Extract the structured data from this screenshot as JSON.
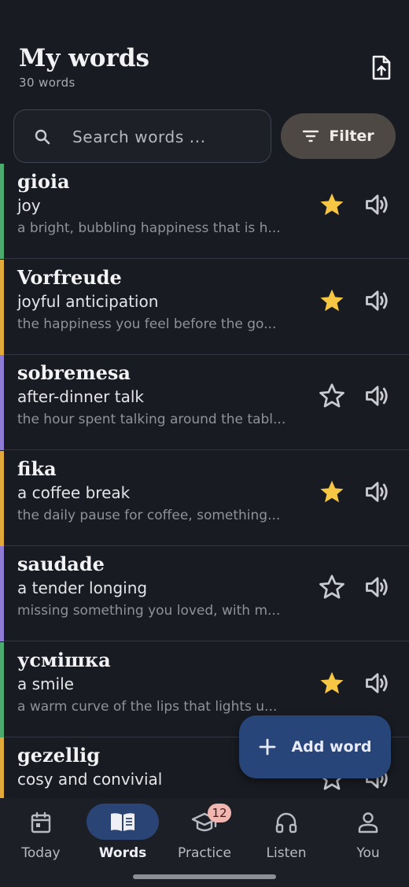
{
  "header": {
    "title": "My words",
    "subtitle": "30 words",
    "export_icon": "export-upload-icon"
  },
  "search": {
    "placeholder": "Search words ...",
    "value": ""
  },
  "filter": {
    "label": "Filter"
  },
  "colors": {
    "green": "#4caa6e",
    "amber": "#e0a93a",
    "purple": "#8e7bd6",
    "star_filled": "#f7c744",
    "accent_blue": "#2a4575"
  },
  "words": [
    {
      "word": "gioia",
      "translation": "joy",
      "description": "a bright, bubbling happiness that is h...",
      "starred": true,
      "accent": "#4caa6e"
    },
    {
      "word": "Vorfreude",
      "translation": "joyful anticipation",
      "description": "the happiness you feel before the go...",
      "starred": true,
      "accent": "#e0a93a"
    },
    {
      "word": "sobremesa",
      "translation": "after-dinner talk",
      "description": "the hour spent talking around the tabl...",
      "starred": false,
      "accent": "#8e7bd6"
    },
    {
      "word": "fika",
      "translation": "a coffee break",
      "description": "the daily pause for coffee, something...",
      "starred": true,
      "accent": "#e0a93a"
    },
    {
      "word": "saudade",
      "translation": "a tender longing",
      "description": "missing something you loved, with m...",
      "starred": false,
      "accent": "#8e7bd6"
    },
    {
      "word": "усмішка",
      "translation": "a smile",
      "description": "a warm curve of the lips that lights u...",
      "starred": true,
      "accent": "#4caa6e"
    },
    {
      "word": "gezellig",
      "translation": "cosy and convivial",
      "description": "",
      "starred": false,
      "accent": "#e0a93a"
    }
  ],
  "fab": {
    "label": "Add word"
  },
  "nav": {
    "items": [
      {
        "label": "Today",
        "icon": "calendar-icon"
      },
      {
        "label": "Words",
        "icon": "book-icon",
        "active": true
      },
      {
        "label": "Practice",
        "icon": "graduation-cap-icon",
        "badge": "12"
      },
      {
        "label": "Listen",
        "icon": "headphones-icon"
      },
      {
        "label": "You",
        "icon": "person-icon"
      }
    ]
  }
}
